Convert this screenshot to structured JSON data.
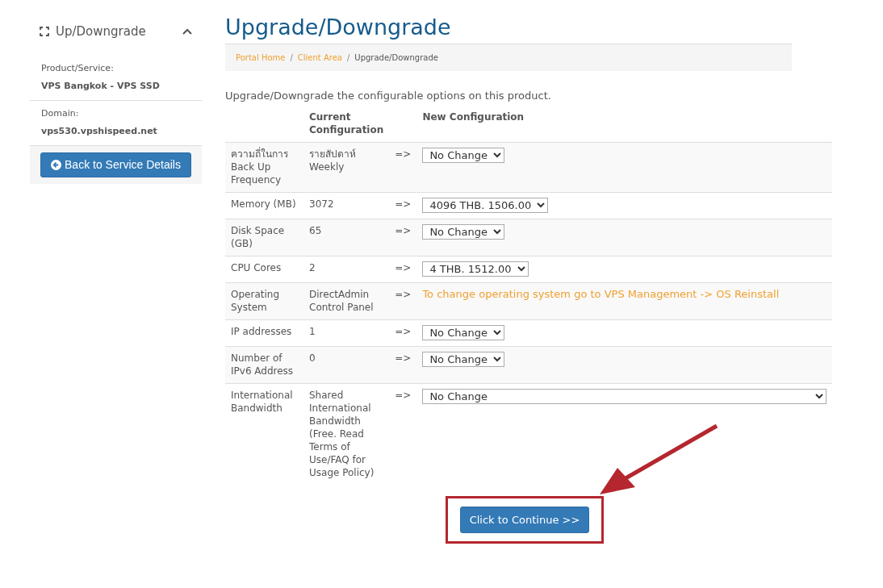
{
  "sidebar": {
    "title": "Up/Downgrade",
    "expanded": true,
    "fields": [
      {
        "label": "Product/Service:",
        "value": "VPS Bangkok - VPS SSD"
      },
      {
        "label": "Domain:",
        "value": "vps530.vpshispeed.net"
      }
    ],
    "button": "Back to Service Details"
  },
  "page_title": "Upgrade/Downgrade",
  "breadcrumb": [
    {
      "label": "Portal Home",
      "link": true
    },
    {
      "separator": "/",
      "label": "Client Area",
      "link": true
    },
    {
      "separator": "/",
      "label": "Upgrade/Downgrade",
      "link": false
    }
  ],
  "intro": "Upgrade/Downgrade the configurable options on this product.",
  "table": {
    "columns": [
      "Current Configuration",
      "New Configuration"
    ],
    "rows": [
      {
        "kind": "select",
        "option": "ความถี่ในการ Back Up Frequency",
        "current": "รายสัปดาห์ Weekly",
        "arrow": "=>",
        "value": "No Change"
      },
      {
        "kind": "select",
        "option": "Memory (MB)",
        "current": "3072",
        "arrow": "=>",
        "value": "4096 THB. 1506.00"
      },
      {
        "kind": "select",
        "option": "Disk Space (GB)",
        "current": "65",
        "arrow": "=>",
        "value": "No Change"
      },
      {
        "kind": "select",
        "option": "CPU Cores",
        "current": "2",
        "arrow": "=>",
        "value": "4 THB. 1512.00"
      },
      {
        "kind": "note",
        "option": "Operating System",
        "current": "DirectAdmin Control Panel",
        "arrow": "=>",
        "value": "To change operating system go to VPS Management -> OS Reinstall"
      },
      {
        "kind": "select",
        "option": "IP addresses",
        "current": "1",
        "arrow": "=>",
        "value": "No Change"
      },
      {
        "kind": "select",
        "option": "Number of IPv6 Address",
        "current": "0",
        "arrow": "=>",
        "value": "No Change"
      },
      {
        "kind": "select",
        "option": "International Bandwidth",
        "current": "Shared International Bandwidth (Free. Read Terms of Use/FAQ for Usage Policy)",
        "arrow": "=>",
        "value": "No Change"
      }
    ]
  },
  "continue_button": "Click to Continue >>",
  "annotation": {
    "highlight": true,
    "arrow": true
  }
}
